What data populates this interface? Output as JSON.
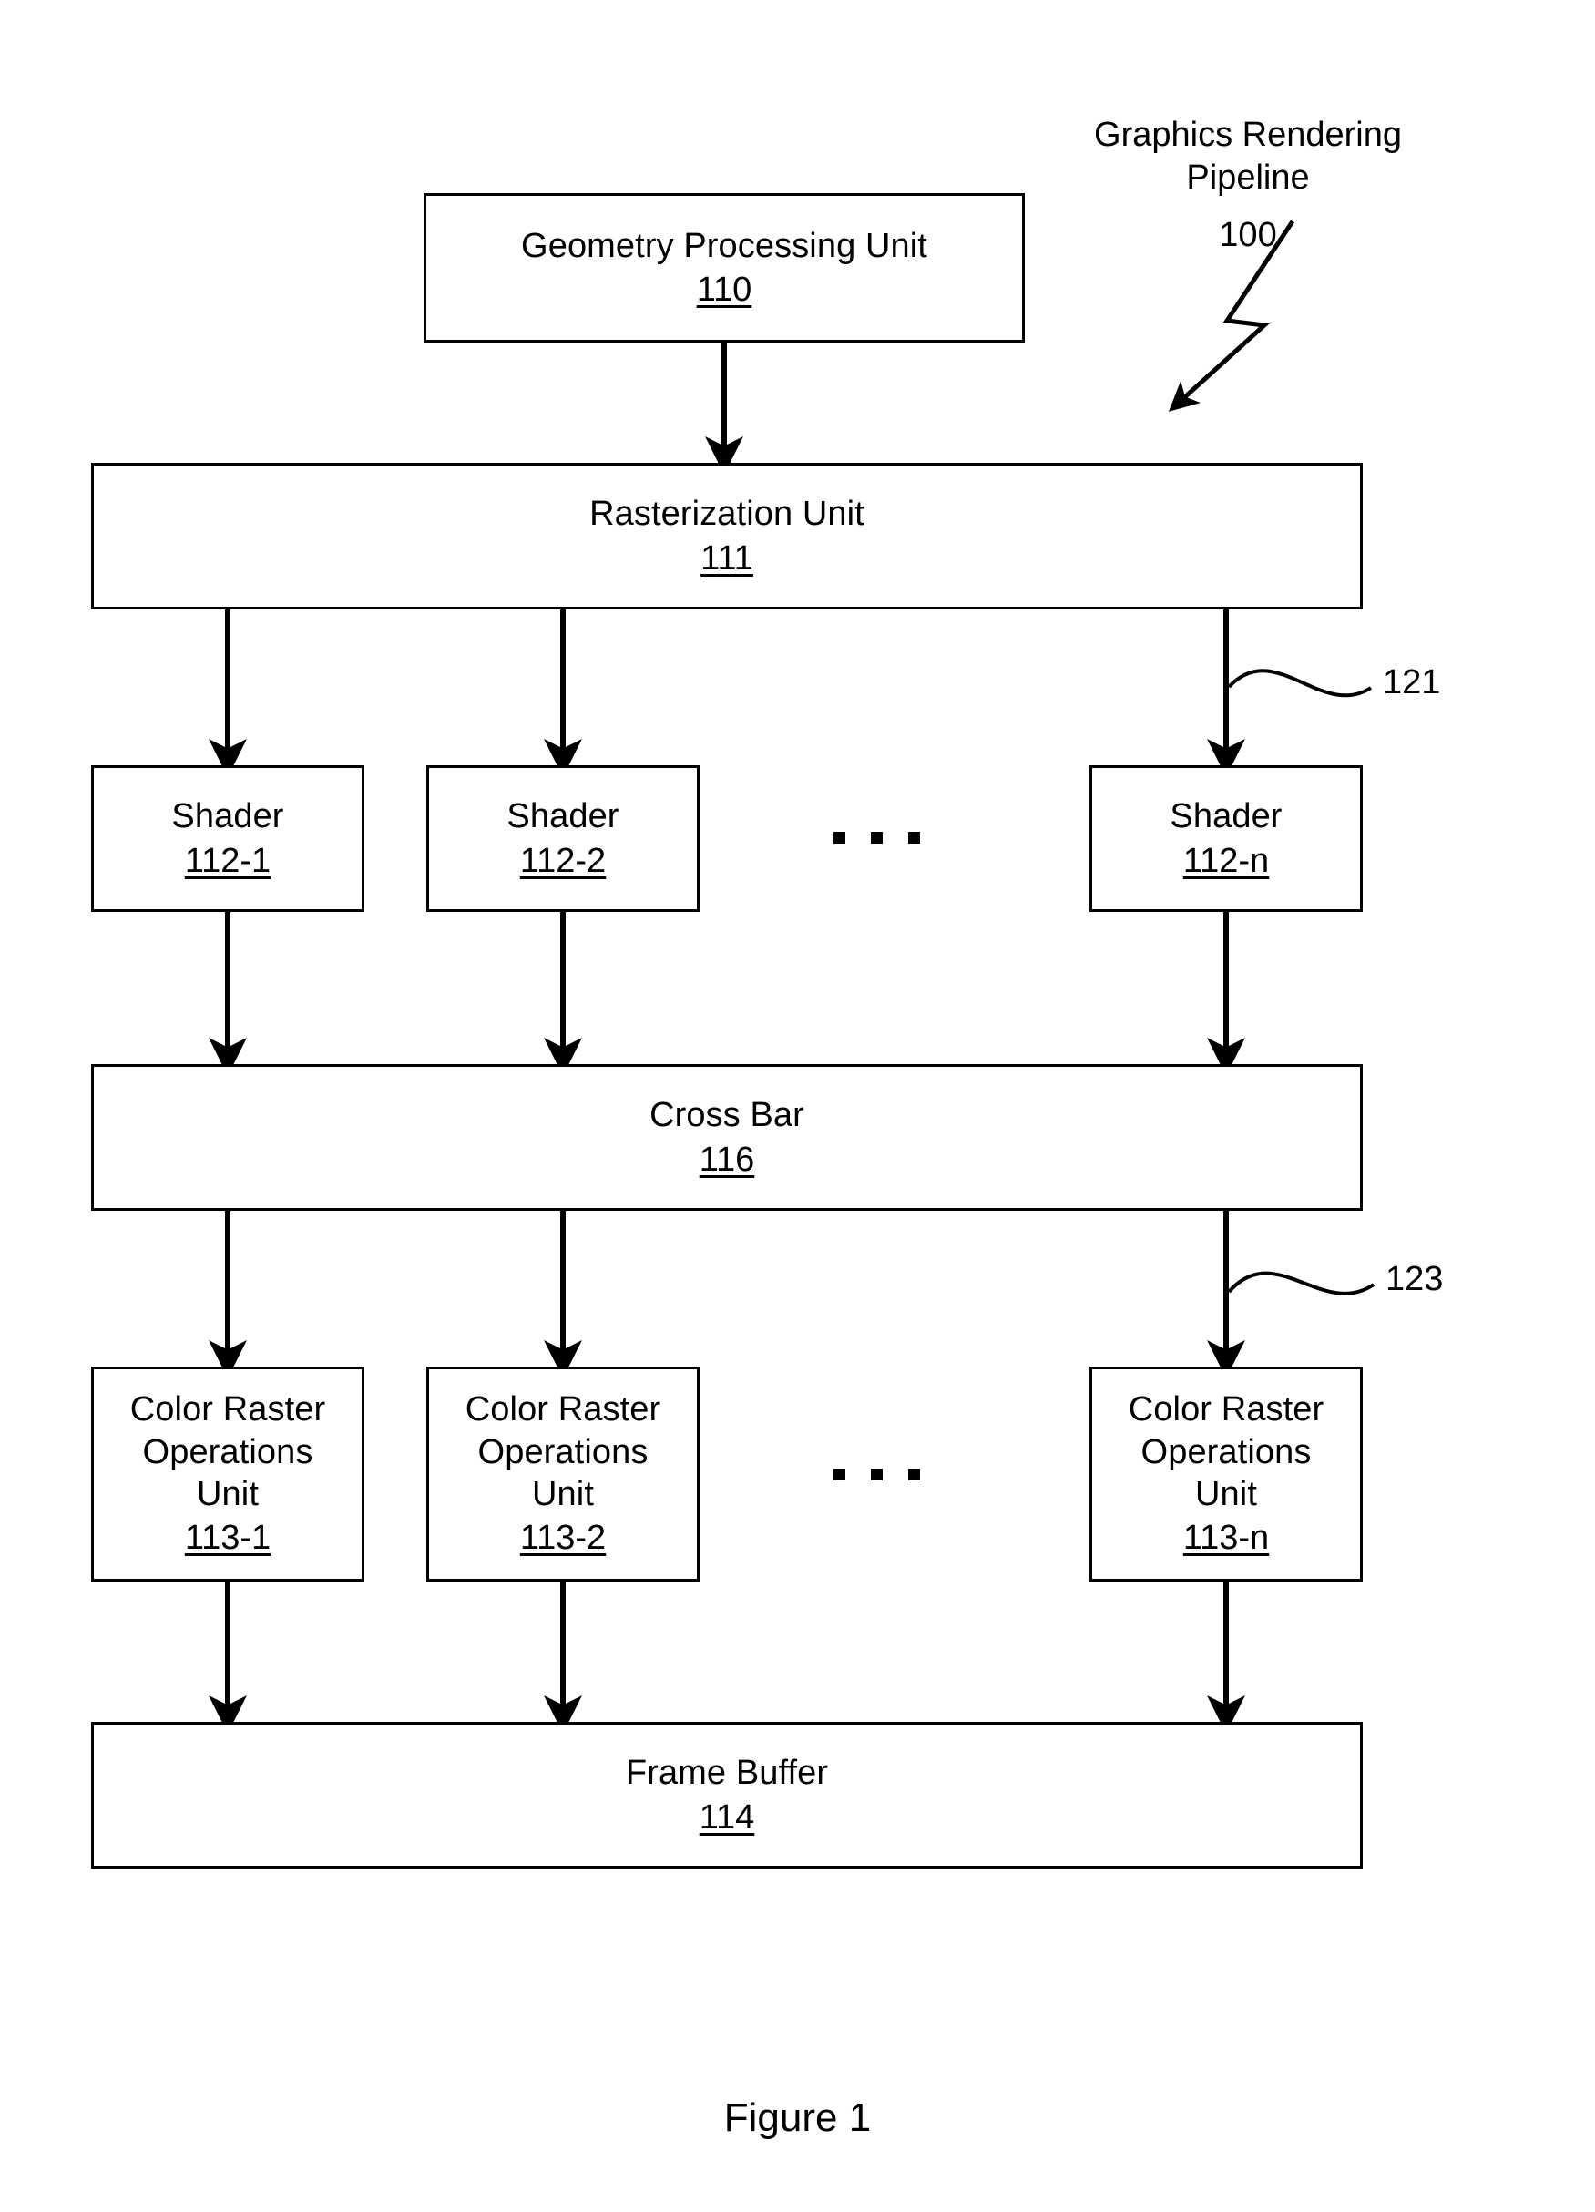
{
  "figure": {
    "caption": "Figure 1",
    "system_label": "Graphics Rendering Pipeline",
    "system_refnum": "100"
  },
  "nodes": {
    "geometry_processing_unit": {
      "title": "Geometry Processing Unit",
      "refnum": "110"
    },
    "rasterization_unit": {
      "title": "Rasterization Unit",
      "refnum": "111"
    },
    "shader_1": {
      "title": "Shader",
      "refnum": "112-1"
    },
    "shader_2": {
      "title": "Shader",
      "refnum": "112-2"
    },
    "shader_n": {
      "title": "Shader",
      "refnum": "112-n"
    },
    "cross_bar": {
      "title": "Cross Bar",
      "refnum": "116"
    },
    "crop_1": {
      "title": "Color Raster\nOperations\nUnit",
      "refnum": "113-1"
    },
    "crop_2": {
      "title": "Color Raster\nOperations\nUnit",
      "refnum": "113-2"
    },
    "crop_n": {
      "title": "Color Raster\nOperations\nUnit",
      "refnum": "113-n"
    },
    "frame_buffer": {
      "title": "Frame Buffer",
      "refnum": "114"
    }
  },
  "connector_labels": {
    "shader_bus": "121",
    "crop_bus": "123"
  },
  "colors": {
    "ink": "#000000",
    "paper": "#ffffff"
  }
}
